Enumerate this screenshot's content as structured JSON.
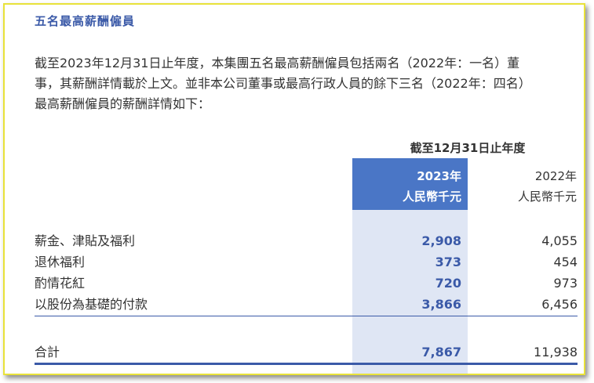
{
  "heading": "五名最高薪酬僱員",
  "paragraph": [
    "截至2023年12月31日止年度，本集團五名最高薪酬僱員包括兩名（2022年：一名）董",
    "事，其薪酬詳情載於上文。並非本公司董事或最高行政人員的餘下三名（2022年：四名）",
    "最高薪酬僱員的薪酬詳情如下："
  ],
  "table": {
    "period_label": "截至12月31日止年度",
    "columns": [
      {
        "year": "2023年",
        "unit": "人民幣千元"
      },
      {
        "year": "2022年",
        "unit": "人民幣千元"
      }
    ],
    "rows": [
      {
        "label": "薪金、津貼及福利",
        "v2023": "2,908",
        "v2022": "4,055"
      },
      {
        "label": "退休福利",
        "v2023": "373",
        "v2022": "454"
      },
      {
        "label": "酌情花紅",
        "v2023": "720",
        "v2022": "973"
      },
      {
        "label": "以股份為基礎的付款",
        "v2023": "3,866",
        "v2022": "6,456"
      }
    ],
    "total": {
      "label": "合計",
      "v2023": "7,867",
      "v2022": "11,938"
    }
  },
  "colors": {
    "accent": "#3b5aa8",
    "header_fill": "#4a76c6",
    "column_band": "#dfe6f4",
    "frame_border": "#e8e23a"
  }
}
